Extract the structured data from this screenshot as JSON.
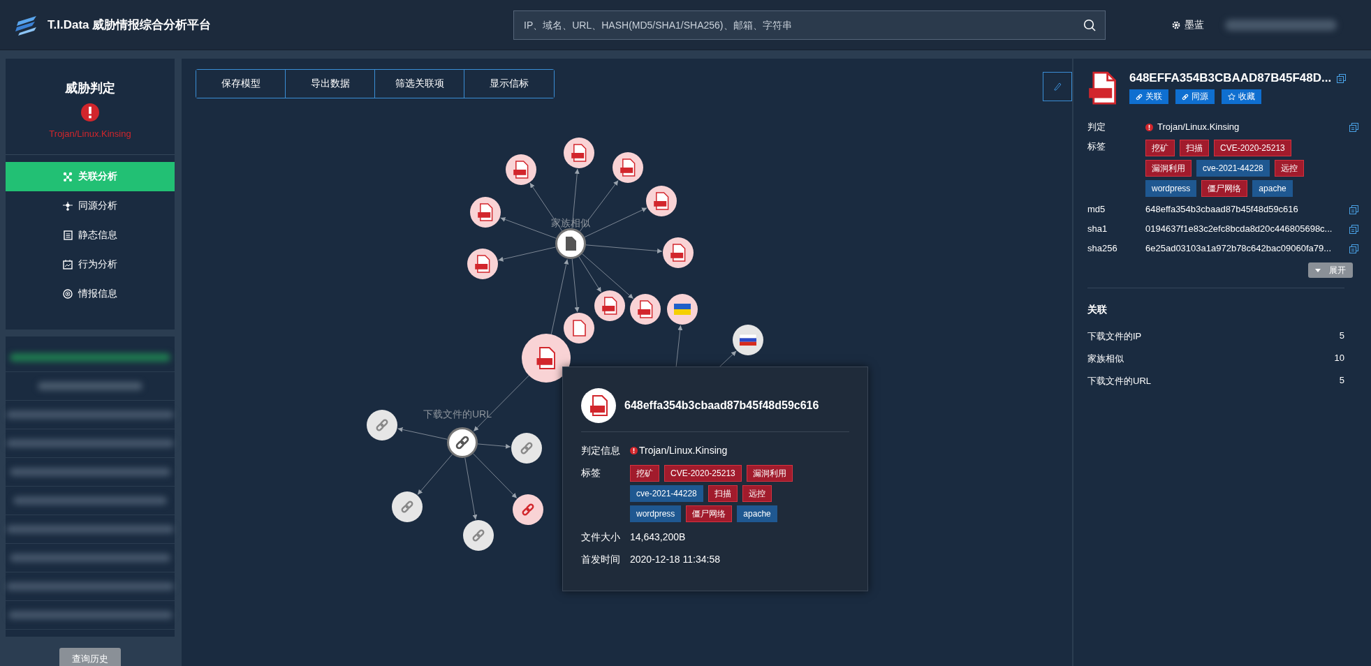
{
  "header": {
    "title": "T.I.Data 威胁情报综合分析平台",
    "search": {
      "placeholder": "IP、域名、URL、HASH(MD5/SHA1/SHA256)、邮箱、字符串"
    },
    "theme_label": "墨蓝"
  },
  "sidebar": {
    "heading": "威胁判定",
    "verdict": "Trojan/Linux.Kinsing",
    "items": [
      {
        "label": "关联分析",
        "selected": true
      },
      {
        "label": "同源分析",
        "selected": false
      },
      {
        "label": "静态信息",
        "selected": false
      },
      {
        "label": "行为分析",
        "selected": false
      },
      {
        "label": "情报信息",
        "selected": false
      }
    ],
    "history_button": "查询历史"
  },
  "toolbar": {
    "buttons": [
      "保存模型",
      "导出数据",
      "筛选关联项",
      "显示信标"
    ]
  },
  "graph": {
    "group_labels": [
      "家族相似",
      "下载文件的URL"
    ],
    "nodes": [
      {
        "kind": "family"
      },
      {
        "kind": "elf"
      },
      {
        "kind": "elf"
      },
      {
        "kind": "elf"
      },
      {
        "kind": "elf"
      },
      {
        "kind": "elf"
      },
      {
        "kind": "elf"
      },
      {
        "kind": "elf"
      },
      {
        "kind": "elf"
      },
      {
        "kind": "elf"
      },
      {
        "kind": "file"
      },
      {
        "kind": "flag_ua"
      },
      {
        "kind": "flag_ru"
      },
      {
        "kind": "sample"
      },
      {
        "kind": "url_group"
      },
      {
        "kind": "link"
      },
      {
        "kind": "link"
      },
      {
        "kind": "link"
      },
      {
        "kind": "link"
      },
      {
        "kind": "link_alert"
      }
    ]
  },
  "tooltip": {
    "hash": "648effa354b3cbaad87b45f48d59c616",
    "fields": [
      {
        "label": "判定信息",
        "kind": "verdict",
        "value": "Trojan/Linux.Kinsing"
      },
      {
        "label": "标签",
        "kind": "tags",
        "tags": [
          {
            "label": "挖矿",
            "color": "#a11b2c"
          },
          {
            "label": "CVE-2020-25213",
            "color": "#a11b2c"
          },
          {
            "label": "漏洞利用",
            "color": "#a11b2c"
          },
          {
            "label": "cve-2021-44228",
            "color": "#1f5891"
          },
          {
            "label": "扫描",
            "color": "#a11b2c"
          },
          {
            "label": "远控",
            "color": "#a11b2c"
          },
          {
            "label": "wordpress",
            "color": "#1f5891"
          },
          {
            "label": "僵尸网络",
            "color": "#a11b2c"
          },
          {
            "label": "apache",
            "color": "#1f5891"
          }
        ]
      },
      {
        "label": "文件大小",
        "kind": "text",
        "value": "14,643,200B"
      },
      {
        "label": "首发时间",
        "kind": "text",
        "value": "2020-12-18 11:34:58"
      }
    ]
  },
  "detail": {
    "title": "648EFFA354B3CBAAD87B45F48D...",
    "actions": [
      "关联",
      "同源",
      "收藏"
    ],
    "verdict_label": "判定",
    "verdict": "Trojan/Linux.Kinsing",
    "tags_label": "标签",
    "tags": [
      {
        "label": "挖矿",
        "color": "#a11b2c"
      },
      {
        "label": "扫描",
        "color": "#a11b2c"
      },
      {
        "label": "CVE-2020-25213",
        "color": "#a11b2c"
      },
      {
        "label": "漏洞利用",
        "color": "#a11b2c"
      },
      {
        "label": "cve-2021-44228",
        "color": "#1f5891"
      },
      {
        "label": "远控",
        "color": "#a11b2c"
      },
      {
        "label": "wordpress",
        "color": "#1f5891"
      },
      {
        "label": "僵尸网络",
        "color": "#a11b2c"
      },
      {
        "label": "apache",
        "color": "#1f5891"
      }
    ],
    "hashes": [
      {
        "label": "md5",
        "value": "648effa354b3cbaad87b45f48d59c616"
      },
      {
        "label": "sha1",
        "value": "0194637f1e83c2efc8bcda8d20c446805698c..."
      },
      {
        "label": "sha256",
        "value": "6e25ad03103a1a972b78c642bac09060fa79..."
      }
    ],
    "expand_button": "展开",
    "relations_title": "关联",
    "relations": [
      {
        "label": "下载文件的IP",
        "count": "5"
      },
      {
        "label": "家族相似",
        "count": "10"
      },
      {
        "label": "下载文件的URL",
        "count": "5"
      }
    ]
  }
}
